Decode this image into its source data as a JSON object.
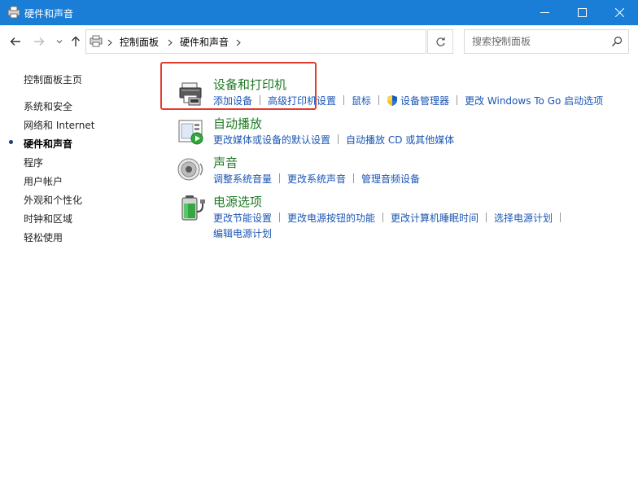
{
  "window": {
    "title": "硬件和声音"
  },
  "address": {
    "crumbs": [
      "控制面板",
      "硬件和声音"
    ],
    "search_placeholder": "搜索控制面板"
  },
  "leftnav": {
    "home": "控制面板主页",
    "items": [
      "系统和安全",
      "网络和 Internet",
      "硬件和声音",
      "程序",
      "用户帐户",
      "外观和个性化",
      "时钟和区域",
      "轻松使用"
    ],
    "current_index": 2
  },
  "categories": [
    {
      "title": "设备和打印机",
      "icon": "printer-icon",
      "tasks": [
        "添加设备",
        "高级打印机设置",
        "鼠标",
        "设备管理器",
        "更改 Windows To Go 启动选项"
      ]
    },
    {
      "title": "自动播放",
      "icon": "autoplay-icon",
      "tasks": [
        "更改媒体或设备的默认设置",
        "自动播放 CD 或其他媒体"
      ]
    },
    {
      "title": "声音",
      "icon": "speaker-icon",
      "tasks": [
        "调整系统音量",
        "更改系统声音",
        "管理音频设备"
      ]
    },
    {
      "title": "电源选项",
      "icon": "battery-icon",
      "tasks": [
        "更改节能设置",
        "更改电源按钮的功能",
        "更改计算机睡眠时间",
        "选择电源计划",
        "编辑电源计划"
      ]
    }
  ],
  "colors": {
    "titlebar": "#1a7dd6",
    "category_title": "#207a27",
    "link": "#1a55b4",
    "highlight": "#e33b2e"
  }
}
